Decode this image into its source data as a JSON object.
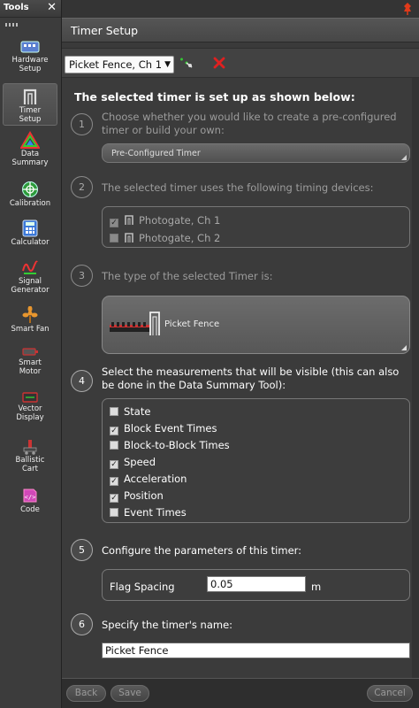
{
  "sidebar": {
    "title": "Tools",
    "items": [
      {
        "label1": "Hardware",
        "label2": "Setup",
        "icon": "hardware-icon"
      },
      {
        "label1": "Timer",
        "label2": "Setup",
        "icon": "timer-gate-icon"
      },
      {
        "label1": "Data",
        "label2": "Summary",
        "icon": "data-summary-icon"
      },
      {
        "label1": "Calibration",
        "label2": "",
        "icon": "calibration-icon"
      },
      {
        "label1": "Calculator",
        "label2": "",
        "icon": "calculator-icon"
      },
      {
        "label1": "Signal",
        "label2": "Generator",
        "icon": "signal-generator-icon"
      },
      {
        "label1": "Smart Fan",
        "label2": "",
        "icon": "smart-fan-icon"
      },
      {
        "label1": "Smart",
        "label2": "Motor",
        "icon": "smart-motor-icon"
      },
      {
        "label1": "Vector",
        "label2": "Display",
        "icon": "vector-display-icon"
      },
      {
        "label1": "Ballistic",
        "label2": "Cart",
        "icon": "ballistic-cart-icon"
      },
      {
        "label1": "Code",
        "label2": "",
        "icon": "code-icon"
      }
    ]
  },
  "panel": {
    "title": "Timer Setup",
    "timer_selector": "Picket Fence, Ch 1",
    "heading": "The selected timer is set up as shown below:"
  },
  "steps": {
    "s1": {
      "num": "1",
      "text": "Choose whether you would like to create a pre-configured timer or build your own:",
      "dropdown": "Pre-Configured Timer"
    },
    "s2": {
      "num": "2",
      "text": "The selected timer uses the following timing devices:",
      "devices": [
        {
          "label": "Photogate, Ch 1",
          "checked": true
        },
        {
          "label": "Photogate, Ch 2",
          "checked": false
        }
      ]
    },
    "s3": {
      "num": "3",
      "text": "The type of the selected Timer is:",
      "type_label": "Picket Fence"
    },
    "s4": {
      "num": "4",
      "text": "Select the measurements that will be visible (this can also be done in the Data Summary Tool):",
      "measurements": [
        {
          "label": "State",
          "checked": false
        },
        {
          "label": "Block Event Times",
          "checked": true
        },
        {
          "label": "Block-to-Block Times",
          "checked": false
        },
        {
          "label": "Speed",
          "checked": true
        },
        {
          "label": "Acceleration",
          "checked": true
        },
        {
          "label": "Position",
          "checked": true
        },
        {
          "label": "Event Times",
          "checked": false
        }
      ]
    },
    "s5": {
      "num": "5",
      "text": "Configure the parameters of this timer:",
      "param_label": "Flag Spacing",
      "param_value": "0.05",
      "param_unit": "m"
    },
    "s6": {
      "num": "6",
      "text": "Specify the timer's name:",
      "name_value": "Picket Fence"
    }
  },
  "buttons": {
    "back": "Back",
    "save": "Save",
    "cancel": "Cancel"
  },
  "colors": {
    "accent_red": "#e02020",
    "pin_color": "#e03a1a",
    "background": "#3a3a3a"
  }
}
